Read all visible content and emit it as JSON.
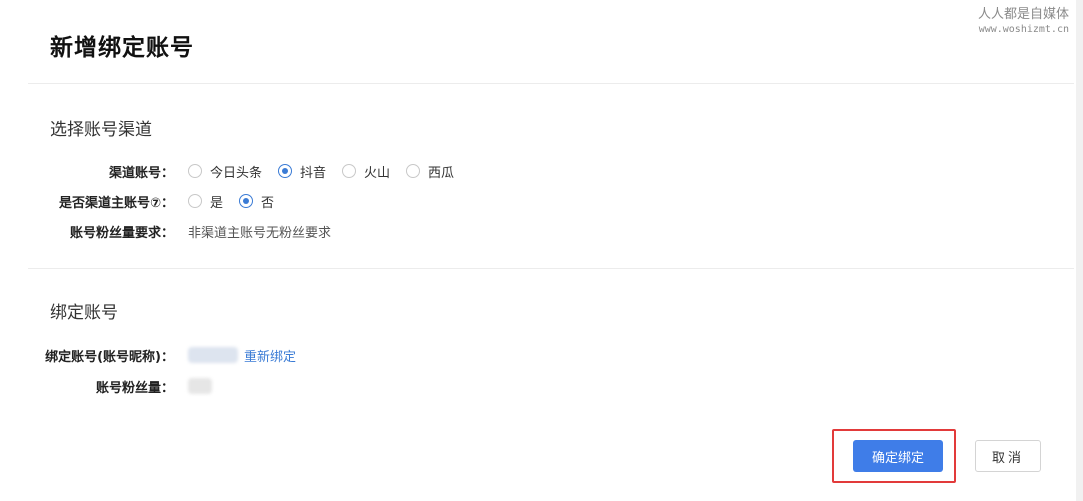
{
  "watermark": {
    "line1": "人人都是自媒体",
    "line2": "www.woshizmt.cn"
  },
  "dialog": {
    "title": "新增绑定账号"
  },
  "section_channel": {
    "title": "选择账号渠道",
    "channel_label": "渠道账号：",
    "channel_options": [
      {
        "label": "今日头条",
        "checked": false
      },
      {
        "label": "抖音",
        "checked": true
      },
      {
        "label": "火山",
        "checked": false
      },
      {
        "label": "西瓜",
        "checked": false
      }
    ],
    "main_label": "是否渠道主账号⑦：",
    "main_options": [
      {
        "label": "是",
        "checked": false
      },
      {
        "label": "否",
        "checked": true
      }
    ],
    "fans_req_label": "账号粉丝量要求：",
    "fans_req_value": "非渠道主账号无粉丝要求"
  },
  "section_bind": {
    "title": "绑定账号",
    "account_label": "绑定账号(账号昵称)：",
    "rebind_link": "重新绑定",
    "fans_label": "账号粉丝量："
  },
  "footer": {
    "confirm_label": "确定绑定",
    "cancel_label": "取消"
  },
  "colors": {
    "accent": "#3f7de8",
    "highlight": "#e23a3a"
  }
}
